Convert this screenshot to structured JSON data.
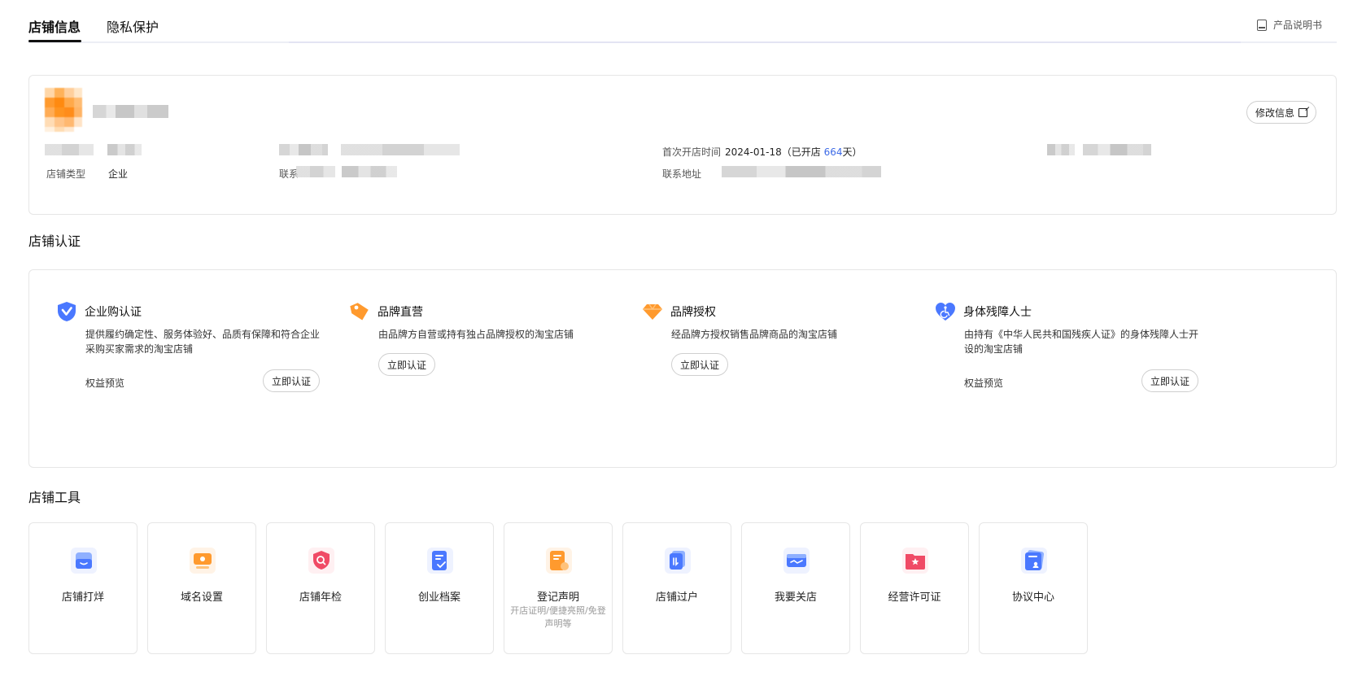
{
  "tabs": [
    {
      "label": "店铺信息",
      "active": true
    },
    {
      "label": "隐私保护",
      "active": false
    }
  ],
  "manual": {
    "label": "产品说明书",
    "icon": "book-icon"
  },
  "shop_info": {
    "edit_label": "修改信息",
    "open_time_label": "首次开店时间",
    "open_time_value": "2024-01-18",
    "open_days_prefix": "（已开店 ",
    "open_days": "664",
    "open_days_suffix": "天）",
    "type_label": "店铺类型",
    "type_value": "企业",
    "contact_label": "联系",
    "address_label": "联系地址"
  },
  "certification": {
    "title": "店铺认证",
    "items": [
      {
        "title": "企业购认证",
        "desc": "提供履约确定性、服务体验好、品质有保障和符合企业采购买家需求的淘宝店铺",
        "rights": "权益预览",
        "button": "立即认证",
        "icon": "shield-check-icon"
      },
      {
        "title": "品牌直营",
        "desc": "由品牌方自营或持有独占品牌授权的淘宝店铺",
        "button": "立即认证",
        "icon": "tag-icon"
      },
      {
        "title": "品牌授权",
        "desc": "经品牌方授权销售品牌商品的淘宝店铺",
        "button": "立即认证",
        "icon": "diamond-icon"
      },
      {
        "title": "身体残障人士",
        "desc": "由持有《中华人民共和国残疾人证》的身体残障人士开设的淘宝店铺",
        "rights": "权益预览",
        "button": "立即认证",
        "icon": "heart-accessibility-icon"
      }
    ]
  },
  "tools": {
    "title": "店铺工具",
    "items": [
      {
        "label": "店铺打烊",
        "icon": "store-close-icon"
      },
      {
        "label": "域名设置",
        "icon": "domain-icon"
      },
      {
        "label": "店铺年检",
        "icon": "shield-search-icon"
      },
      {
        "label": "创业档案",
        "icon": "archive-icon"
      },
      {
        "label": "登记声明",
        "sub": "开店证明/便捷亮照/免登声明等",
        "icon": "document-icon"
      },
      {
        "label": "店铺过户",
        "icon": "transfer-icon"
      },
      {
        "label": "我要关店",
        "icon": "close-store-icon"
      },
      {
        "label": "经营许可证",
        "icon": "license-icon"
      },
      {
        "label": "协议中心",
        "icon": "agreement-icon"
      }
    ]
  },
  "colors": {
    "accent": "#3d6ae6",
    "orange": "#ff9a2e",
    "blue": "#4a78ff",
    "red": "#f04b66"
  }
}
